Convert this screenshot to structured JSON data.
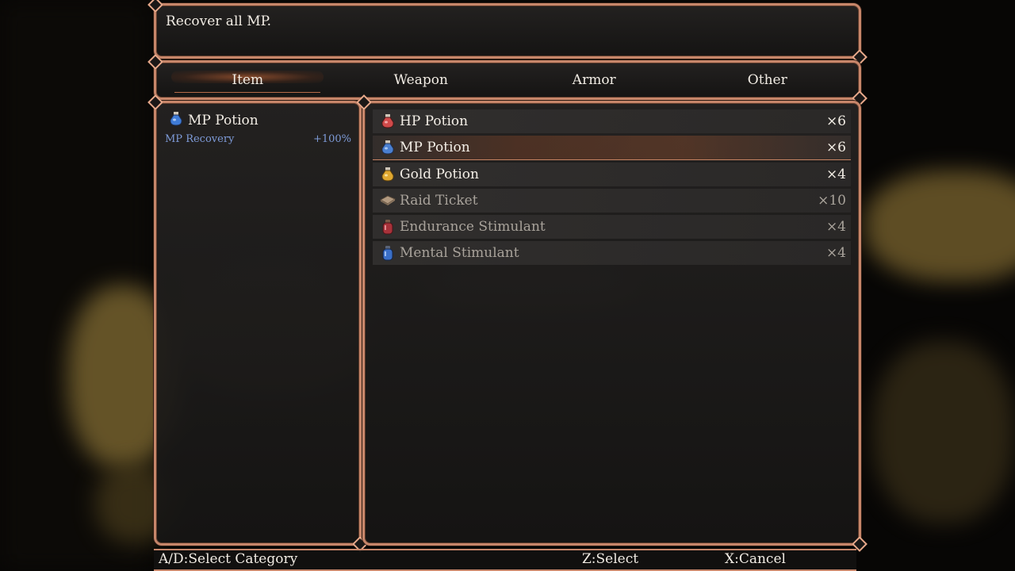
{
  "help": {
    "text": "Recover all MP."
  },
  "categories": [
    {
      "label": "Item",
      "active": true
    },
    {
      "label": "Weapon",
      "active": false
    },
    {
      "label": "Armor",
      "active": false
    },
    {
      "label": "Other",
      "active": false
    }
  ],
  "detail": {
    "name": "MP Potion",
    "icon": "blue-potion-icon",
    "stat_label": "MP Recovery",
    "stat_value": "+100%"
  },
  "items": [
    {
      "name": "HP Potion",
      "count": "×6",
      "icon": "red-potion-icon",
      "color": "#d04a4a",
      "selected": false,
      "dim": false
    },
    {
      "name": "MP Potion",
      "count": "×6",
      "icon": "blue-potion-icon",
      "color": "#4a7fd0",
      "selected": true,
      "dim": false
    },
    {
      "name": "Gold Potion",
      "count": "×4",
      "icon": "gold-potion-icon",
      "color": "#e0a830",
      "selected": false,
      "dim": false
    },
    {
      "name": "Raid Ticket",
      "count": "×10",
      "icon": "ticket-icon",
      "color": "#a8947c",
      "selected": false,
      "dim": true
    },
    {
      "name": "Endurance Stimulant",
      "count": "×4",
      "icon": "red-bottle-icon",
      "color": "#a8323a",
      "selected": false,
      "dim": true
    },
    {
      "name": "Mental Stimulant",
      "count": "×4",
      "icon": "blue-bottle-icon",
      "color": "#3a6fc8",
      "selected": false,
      "dim": true
    }
  ],
  "hints": {
    "category": "A/D:Select Category",
    "select": "Z:Select",
    "cancel": "X:Cancel"
  }
}
